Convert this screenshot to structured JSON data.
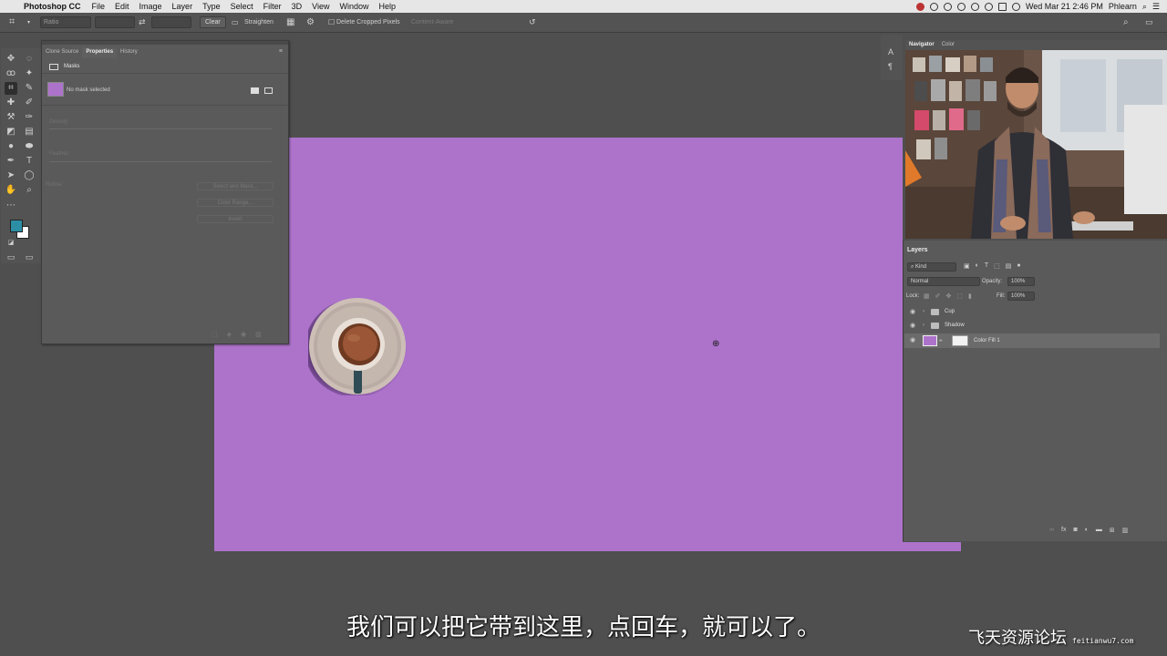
{
  "menubar": {
    "app_name": "Photoshop CC",
    "items": [
      "File",
      "Edit",
      "Image",
      "Layer",
      "Type",
      "Select",
      "Filter",
      "3D",
      "View",
      "Window",
      "Help"
    ],
    "datetime": "Wed Mar 21  2:46 PM",
    "user": "Phlearn"
  },
  "options_bar": {
    "ratio_value": "Ratio",
    "clear_label": "Clear",
    "straighten_label": "Straighten",
    "delete_cropped_label": "Delete Cropped Pixels",
    "content_aware_label": "Content-Aware"
  },
  "properties_panel": {
    "tabs": [
      "Clone Source",
      "Properties",
      "History"
    ],
    "active_tab": "Properties",
    "section_title": "Masks",
    "status_text": "No mask selected",
    "density_label": "Density:",
    "feather_label": "Feather:",
    "refine_label": "Refine:",
    "btn_select_mask": "Select and Mask...",
    "btn_color_range": "Color Range...",
    "btn_invert": "Invert"
  },
  "navigator_panel": {
    "tabs": [
      "Navigator",
      "Color"
    ],
    "active_tab": "Navigator"
  },
  "layers_panel": {
    "title": "Layers",
    "filter_kind": "Kind",
    "blend_mode": "Normal",
    "opacity_label": "Opacity:",
    "opacity_value": "100%",
    "lock_label": "Lock:",
    "fill_label": "Fill:",
    "fill_value": "100%",
    "layers": [
      {
        "name": "Cup",
        "type": "group"
      },
      {
        "name": "Shadow",
        "type": "group"
      },
      {
        "name": "Color Fill 1",
        "type": "fill",
        "selected": true
      }
    ]
  },
  "colors": {
    "canvas_fill": "#ad73cb",
    "foreground": "#2d8fa6",
    "background": "#ffffff"
  },
  "subtitle": "我们可以把它带到这里，点回车，就可以了。",
  "watermark": {
    "name": "飞天资源论坛",
    "site": "feitianwu7.com"
  }
}
